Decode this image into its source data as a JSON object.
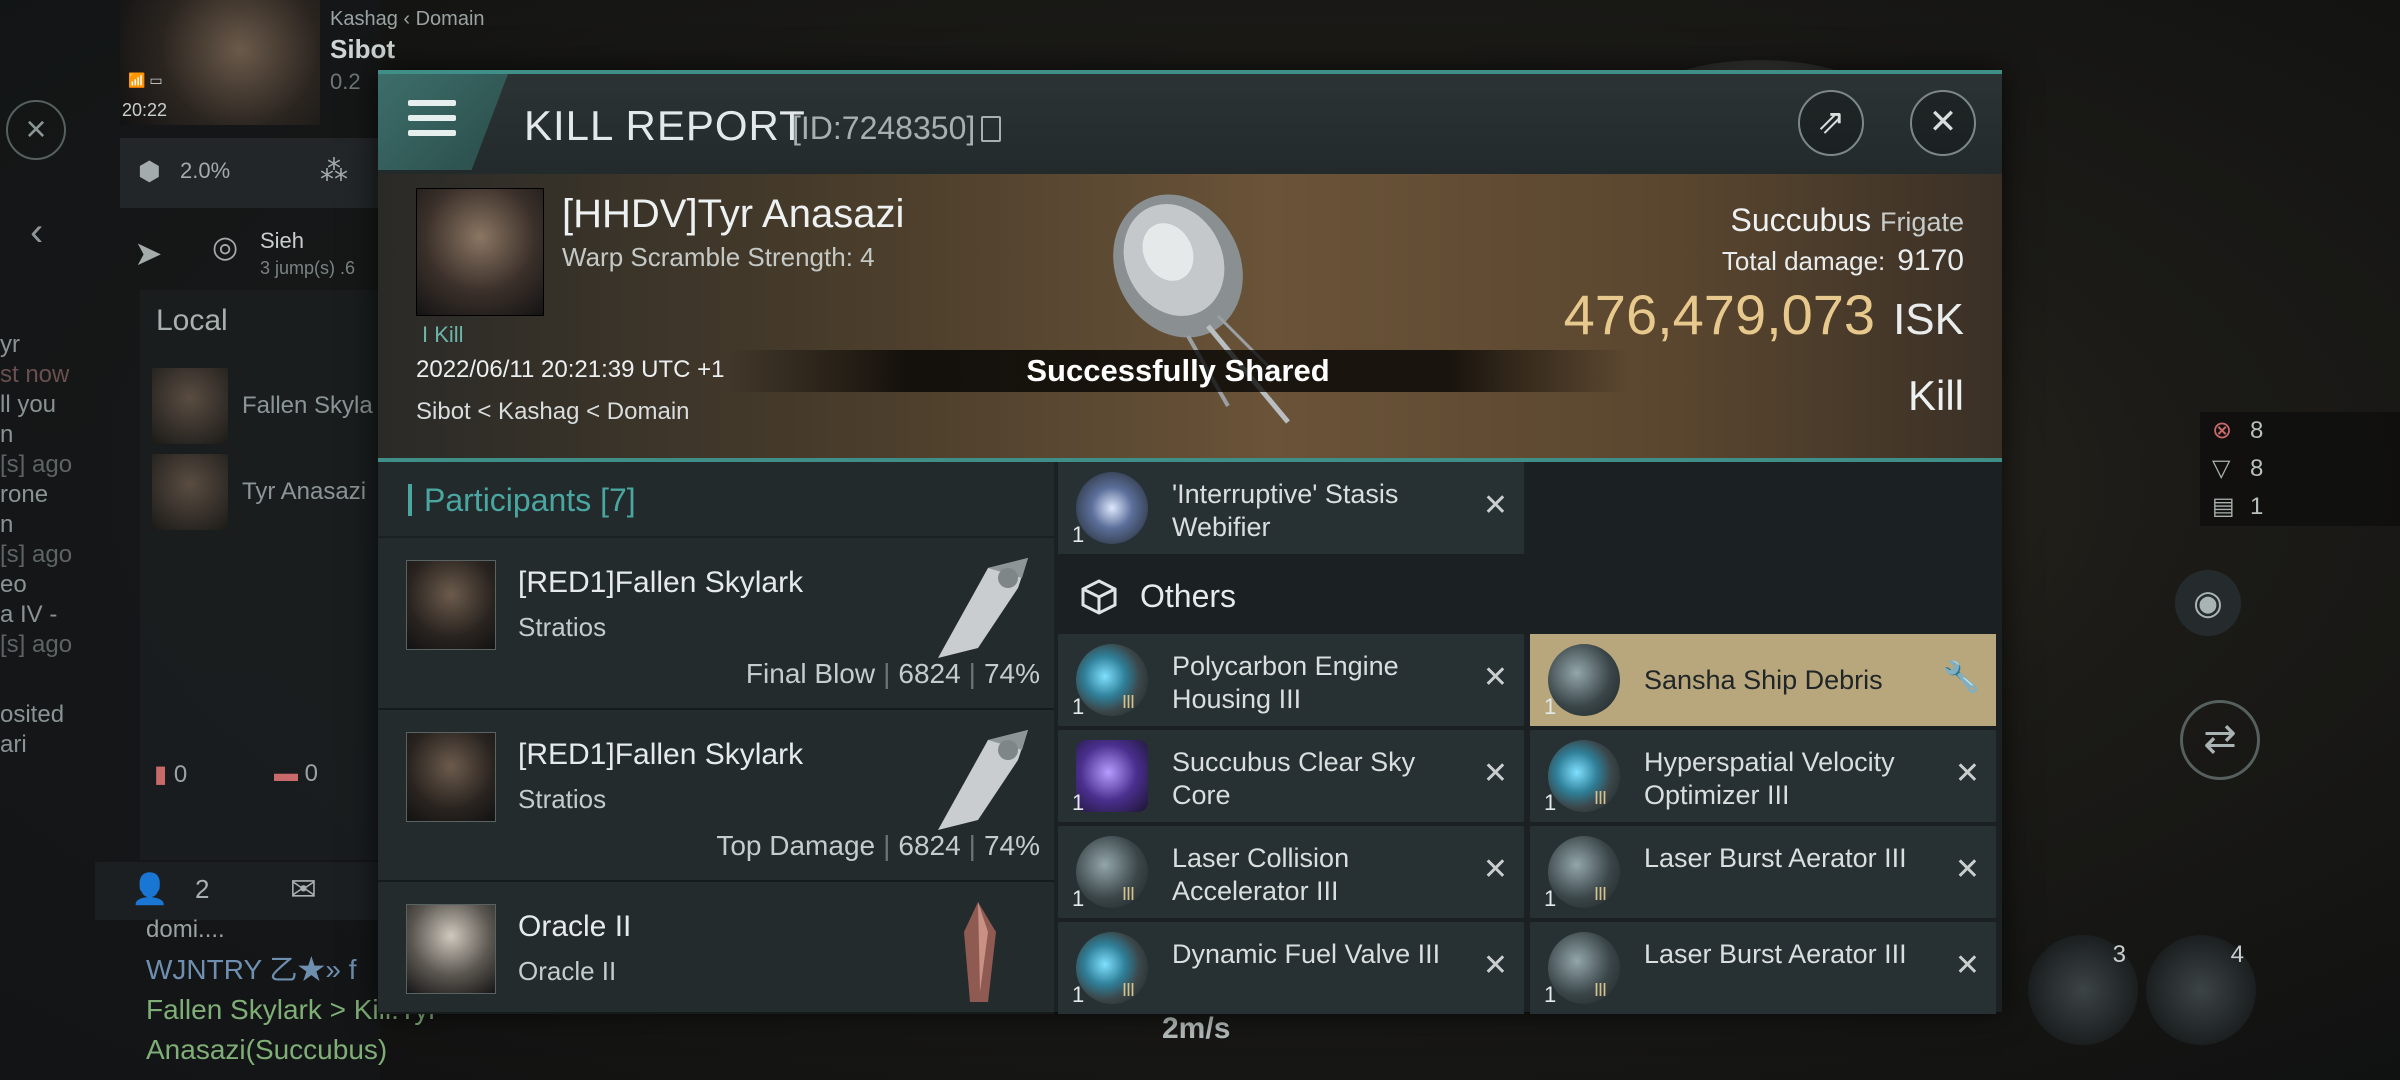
{
  "hud": {
    "pilot": {
      "location": "Kashag  ‹ Domain",
      "name": "Sibot",
      "sec": "0.2",
      "time": "20:22",
      "sub": "Sibot"
    },
    "cargo_pct": "2.0%",
    "route": {
      "system": "Sieh",
      "jumps": "3 jump(s) .6"
    },
    "local": {
      "title": "Local",
      "members": [
        "Fallen Skyla",
        "Tyr Anasazi"
      ]
    },
    "left_chat": [
      "yr",
      "st now",
      "ll you",
      "n",
      "[s] ago",
      "rone",
      "n",
      "[s] ago",
      "eo",
      "a IV -",
      "[s] ago",
      "osited",
      "ari"
    ],
    "counters": {
      "red1": "0",
      "red2": "0"
    },
    "people_count": "2",
    "chat_lines": [
      {
        "text": "domi....",
        "color": "c-grey"
      },
      {
        "text": "WJNTRY 乙★» f",
        "color": "c-blue"
      },
      {
        "text": "Fallen Skylark > Kill:Tyr",
        "color": "c-green"
      },
      {
        "text": "Anasazi(Succubus)",
        "color": "c-green"
      }
    ],
    "right_counts": [
      "8",
      "8",
      "1"
    ],
    "speed": "2m/s",
    "drone_slots": [
      "3",
      "4"
    ]
  },
  "report": {
    "title": "KILL REPORT",
    "id": "[ID:7248350]",
    "victim": {
      "name": "[HHDV]Tyr Anasazi",
      "warp": "Warp Scramble Strength: 4",
      "tag": "I Kill",
      "date": "2022/06/11 20:21:39 UTC +1",
      "location": "Sibot < Kashag < Domain",
      "ship": "Succubus",
      "ship_class": "Frigate",
      "total_damage_label": "Total damage:",
      "total_damage": "9170",
      "isk": "476,479,073",
      "isk_unit": "ISK",
      "result": "Kill"
    },
    "toast": "Successfully Shared",
    "participants": {
      "title": "Participants [7]",
      "rows": [
        {
          "name": "[RED1]Fallen Skylark",
          "ship": "Stratios",
          "role": "Final Blow",
          "damage": "6824",
          "pct": "74%"
        },
        {
          "name": "[RED1]Fallen Skylark",
          "ship": "Stratios",
          "role": "Top Damage",
          "damage": "6824",
          "pct": "74%"
        },
        {
          "name": "Oracle II",
          "ship": "Oracle II",
          "role": "",
          "damage": "",
          "pct": ""
        }
      ]
    },
    "items": {
      "top": {
        "name": "'Interruptive' Stasis Webifier",
        "qty": "1"
      },
      "others_label": "Others",
      "left": [
        {
          "name": "Polycarbon Engine Housing III",
          "qty": "1",
          "meta": "III"
        },
        {
          "name": "Succubus Clear Sky Core",
          "qty": "1",
          "meta": ""
        },
        {
          "name": "Laser Collision Accelerator III",
          "qty": "1",
          "meta": "III"
        },
        {
          "name": "Dynamic Fuel Valve III",
          "qty": "1",
          "meta": "III"
        }
      ],
      "right": [
        {
          "name": "Sansha Ship Debris",
          "qty": "1",
          "meta": ""
        },
        {
          "name": "Hyperspatial Velocity Optimizer III",
          "qty": "1",
          "meta": "III"
        },
        {
          "name": "Laser Burst Aerator III",
          "qty": "1",
          "meta": "III"
        },
        {
          "name": "Laser Burst Aerator III",
          "qty": "1",
          "meta": "III"
        }
      ]
    }
  },
  "colors": {
    "accent": "#3f8e88",
    "isk": "#e8c98d",
    "highlight": "#b8a67c"
  }
}
